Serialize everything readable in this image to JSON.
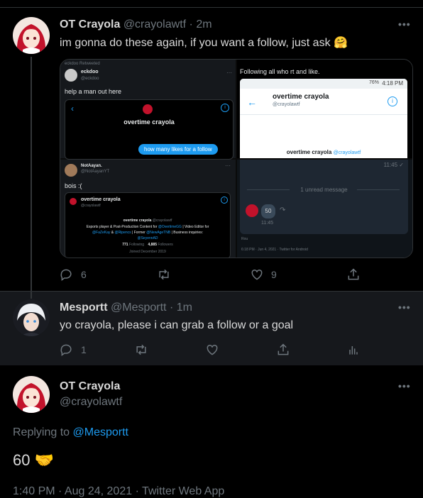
{
  "colors": {
    "accent": "#1d9bf0",
    "muted": "#6e767d",
    "text": "#d9d9d9",
    "bg": "#000000"
  },
  "tweet1": {
    "name": "OT Crayola",
    "handle": "@crayolawtf",
    "time": "2m",
    "text": "im gonna do these again, if you want a follow, just ask 🤗",
    "replies": "6",
    "likes": "9",
    "media": {
      "q1": {
        "retweet_label": "eckdoo Retweeted",
        "name": "eckdoo",
        "handle": "@eckdoo",
        "text": "help a man out here",
        "card_name": "overtime crayola",
        "bubble": "how many likes for a follow"
      },
      "q2": {
        "text": "Following all who rt and like.",
        "status_time": "4:18 PM",
        "status_battery": "76%",
        "profile_name": "overtime crayola",
        "profile_handle": "@crayolawtf",
        "footer_name": "overtime crayola",
        "footer_handle": "@crayolawtf"
      },
      "q3": {
        "name": "NotAayan.",
        "handle": "@NotAayanYT",
        "text": "bois :(",
        "card_name": "overtime crayola",
        "card_handle": "@crayolawtf",
        "bio_name": "overtime crayola",
        "bio_handle": "@crayolawtf",
        "bio1": "Esports player & Post-Production Content for",
        "bio1_link": "@OvertimeGG",
        "bio1_end": "| Video Editor for",
        "bio2_link1": "@FaZeKay",
        "bio2_amp": "&",
        "bio2_link2": "@Ripencs",
        "bio2_mid": "| Former",
        "bio2_link3": "@NewAgeTNB",
        "bio2_end": "| Business inquiries:",
        "bio3_link": "@SeyennAD",
        "following_count": "771",
        "following_label": "Following",
        "followers_count": "4,885",
        "followers_label": "Followers",
        "joined": "Joined December 2019"
      },
      "q4": {
        "time_top": "11:45 ✓",
        "unread": "1 unread message",
        "badge": "50",
        "msg_time": "11:45",
        "footer_name": "Rou",
        "footer_meta": "6:18 PM · Jun 4, 2021 · Twitter for Android"
      }
    }
  },
  "tweet2": {
    "name": "Mesportt",
    "handle": "@Mesportt",
    "time": "1m",
    "text": "yo crayola, please i can grab a follow or a goal",
    "replies": "1"
  },
  "tweet3": {
    "name": "OT Crayola",
    "handle": "@crayolawtf",
    "replying_prefix": "Replying to",
    "replying_handle": "@Mesportt",
    "text": "60 🤝",
    "meta": "1:40 PM · Aug 24, 2021 · Twitter Web App"
  }
}
